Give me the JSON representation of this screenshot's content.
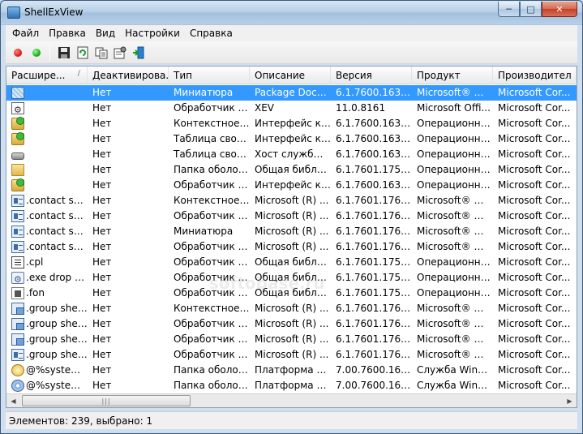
{
  "window": {
    "title": "ShellExView",
    "controls": {
      "minimize": "─",
      "maximize": "□",
      "close": "✕"
    }
  },
  "menu": [
    {
      "label": "Файл"
    },
    {
      "label": "Правка"
    },
    {
      "label": "Вид"
    },
    {
      "label": "Настройки"
    },
    {
      "label": "Справка"
    }
  ],
  "toolbar": {
    "buttons": [
      {
        "name": "disable-button",
        "icon": "red-dot-icon",
        "color": "#e02020"
      },
      {
        "name": "enable-button",
        "icon": "green-dot-icon",
        "color": "#20b020"
      },
      {
        "name": "save-button",
        "icon": "floppy-disk-icon"
      },
      {
        "name": "refresh-button",
        "icon": "refresh-icon"
      },
      {
        "name": "copy-button",
        "icon": "copy-icon"
      },
      {
        "name": "properties-button",
        "icon": "properties-icon"
      },
      {
        "name": "exit-button",
        "icon": "exit-icon"
      }
    ]
  },
  "table": {
    "columns": [
      {
        "label": "Расшире...",
        "sorted": true
      },
      {
        "label": "Деактивирова..."
      },
      {
        "label": "Тип"
      },
      {
        "label": "Описание"
      },
      {
        "label": "Версия"
      },
      {
        "label": "Продукт"
      },
      {
        "label": "Производител"
      }
    ],
    "rows": [
      {
        "icon": "thumbnail-icon",
        "cells": [
          "",
          "Нет",
          "Миниатюра",
          "Package Docu...",
          "6.1.7600.16385 ...",
          "Microsoft® Wi...",
          "Microsoft Cor..."
        ],
        "selected": true
      },
      {
        "icon": "document-gear-icon",
        "cells": [
          "",
          "Нет",
          "Обработчик з...",
          "XEV",
          "11.0.8161",
          "Microsoft Offi...",
          "Microsoft Cor..."
        ]
      },
      {
        "icon": "green-overlay-icon",
        "cells": [
          "",
          "Нет",
          "Контекстное ...",
          "Интерфейс кэ...",
          "6.1.7600.16385 ...",
          "Операционна...",
          "Microsoft Cor..."
        ]
      },
      {
        "icon": "green-overlay-icon",
        "cells": [
          "",
          "Нет",
          "Таблица свой...",
          "Интерфейс кэ...",
          "6.1.7600.16385 ...",
          "Операционна...",
          "Microsoft Cor..."
        ]
      },
      {
        "icon": "drive-icon",
        "cells": [
          "",
          "Нет",
          "Таблица свой...",
          "Хост службы ...",
          "6.1.7600.16385 ...",
          "Операционна...",
          "Microsoft Cor..."
        ]
      },
      {
        "icon": "folder-icon",
        "cells": [
          "",
          "Нет",
          "Папка оболоч...",
          "Общая библи...",
          "6.1.7601.17514 ...",
          "Операционна...",
          "Microsoft Cor..."
        ]
      },
      {
        "icon": "green-overlay-icon",
        "cells": [
          "",
          "Нет",
          "Обработчик н...",
          "Интерфейс кэ...",
          "6.1.7600.16385 ...",
          "Операционна...",
          "Microsoft Cor..."
        ]
      },
      {
        "icon": "contact-card-icon",
        "cells": [
          ".contact shel...",
          "Нет",
          "Контекстное ...",
          "Microsoft (R) ...",
          "6.1.7601.17699 ...",
          "Microsoft® Wi...",
          "Microsoft Cor..."
        ]
      },
      {
        "icon": "contact-card-icon",
        "cells": [
          ".contact shel...",
          "Нет",
          "Обработчик в...",
          "Microsoft (R) ...",
          "6.1.7601.17699 ...",
          "Microsoft® Wi...",
          "Microsoft Cor..."
        ]
      },
      {
        "icon": "contact-card-icon",
        "cells": [
          ".contact shel...",
          "Нет",
          "Миниатюра",
          "Microsoft (R) ...",
          "6.1.7601.17699 ...",
          "Microsoft® Wi...",
          "Microsoft Cor..."
        ]
      },
      {
        "icon": "contact-card-icon",
        "cells": [
          ".contact shel...",
          "Нет",
          "Обработчик с...",
          "Microsoft (R) ...",
          "6.1.7601.17699 ...",
          "Microsoft® Wi...",
          "Microsoft Cor..."
        ]
      },
      {
        "icon": "control-panel-icon",
        "cells": [
          ".cpl",
          "Нет",
          "Обработчик с...",
          "Общая библи...",
          "6.1.7601.17514 ...",
          "Операционна...",
          "Microsoft Cor..."
        ]
      },
      {
        "icon": "exe-gear-icon",
        "cells": [
          ".exe drop tar...",
          "Нет",
          "Обработчик D...",
          "Общая библи...",
          "6.1.7601.17514 ...",
          "Операционна...",
          "Microsoft Cor..."
        ]
      },
      {
        "icon": "font-file-icon",
        "cells": [
          ".fon",
          "Нет",
          "Обработчик с...",
          "Общая библи...",
          "6.1.7601.17514 ...",
          "Операционна...",
          "Microsoft Cor..."
        ]
      },
      {
        "icon": "group-icon",
        "cells": [
          ".group shell ...",
          "Нет",
          "Контекстное ...",
          "Microsoft (R) ...",
          "6.1.7601.17699 ...",
          "Microsoft® Wi...",
          "Microsoft Cor..."
        ]
      },
      {
        "icon": "group-icon",
        "cells": [
          ".group shell ...",
          "Нет",
          "Обработчик D...",
          "Microsoft (R) ...",
          "6.1.7601.17699 ...",
          "Microsoft® Wi...",
          "Microsoft Cor..."
        ]
      },
      {
        "icon": "group-icon",
        "cells": [
          ".group shell ...",
          "Нет",
          "Обработчик в...",
          "Microsoft (R) ...",
          "6.1.7601.17699 ...",
          "Microsoft® Wi...",
          "Microsoft Cor..."
        ]
      },
      {
        "icon": "contact-card-icon",
        "cells": [
          ".group shell ...",
          "Нет",
          "Обработчик с...",
          "Microsoft (R) ...",
          "6.1.7601.17699 ...",
          "Microsoft® Wi...",
          "Microsoft Cor..."
        ]
      },
      {
        "icon": "clock-icon",
        "cells": [
          "@%systemr...",
          "Нет",
          "Папка оболоч...",
          "Платформа Vi...",
          "7.00.7600.1638...",
          "Служба Wind...",
          "Microsoft Cor..."
        ]
      },
      {
        "icon": "disk-icon",
        "cells": [
          "@%systemr...",
          "Нет",
          "Папка оболоч...",
          "Платформа Vi...",
          "7.00.7600.1638...",
          "Служба Wind...",
          "Microsoft Cor..."
        ]
      }
    ]
  },
  "scrollbar": {
    "left": "◀",
    "right": "▶",
    "grip": "|||"
  },
  "status": {
    "text": "Элементов: 239, выбрано: 1"
  },
  "watermark": "softobase.ru",
  "colors": {
    "selection": "#3399ff",
    "accent": "#3a6ea5"
  }
}
